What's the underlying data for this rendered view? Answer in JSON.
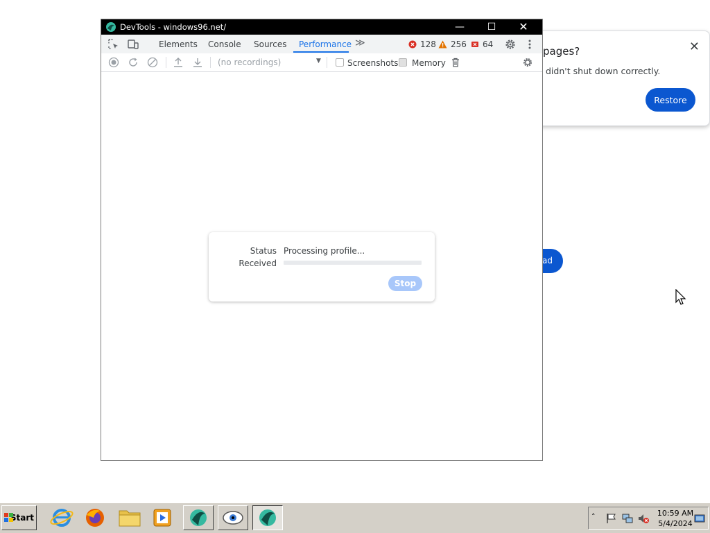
{
  "background": {
    "restore_title": "pages?",
    "restore_message": "didn't shut down correctly.",
    "restore_button": "Restore",
    "pill_text": "ad"
  },
  "devtools": {
    "title": "DevTools - windows96.net/",
    "tabs": [
      {
        "label": "Elements"
      },
      {
        "label": "Console"
      },
      {
        "label": "Sources"
      },
      {
        "label": "Performance",
        "active": true
      }
    ],
    "errors": "128",
    "warnings": "256",
    "issues": "64",
    "recordings_placeholder": "(no recordings)",
    "screenshots_label": "Screenshots",
    "memory_label": "Memory",
    "memory_checked": true,
    "status_label": "Status",
    "status_value": "Processing profile...",
    "received_label": "Received",
    "received_progress": 0,
    "stop_button": "Stop"
  },
  "taskbar": {
    "start_label": "Start",
    "clock_time": "10:59 AM",
    "clock_date": "5/4/2024"
  },
  "colors": {
    "accent": "#1a73e8",
    "restore_button": "#0b57d0",
    "error": "#d93025",
    "warning": "#e37400"
  }
}
